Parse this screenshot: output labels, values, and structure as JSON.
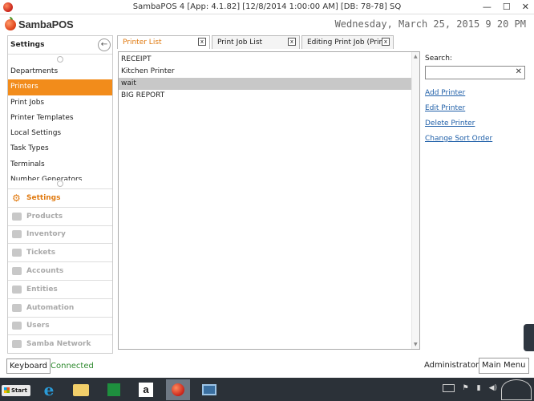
{
  "window": {
    "title": "SambaPOS 4 [App: 4.1.82] [12/8/2014 1:00:00 AM] [DB: 78-78] SQ",
    "minimize": "—",
    "maximize": "☐",
    "close": "✕"
  },
  "header": {
    "logo_text": "SambaPOS",
    "datetime": "Wednesday, March 25, 2015 9 20 PM"
  },
  "sidebar": {
    "title": "Settings",
    "back_icon": "←",
    "items": [
      {
        "label": "Departments"
      },
      {
        "label": "Printers",
        "active": true
      },
      {
        "label": "Print Jobs"
      },
      {
        "label": "Printer Templates"
      },
      {
        "label": "Local Settings"
      },
      {
        "label": "Task Types"
      },
      {
        "label": "Terminals"
      },
      {
        "label": "Number Generators"
      }
    ],
    "sections": [
      {
        "label": "Settings",
        "icon": "gear-icon",
        "active": true
      },
      {
        "label": "Products",
        "icon": "coffee-icon"
      },
      {
        "label": "Inventory",
        "icon": "truck-icon"
      },
      {
        "label": "Tickets",
        "icon": "tickets-icon"
      },
      {
        "label": "Accounts",
        "icon": "calculator-icon"
      },
      {
        "label": "Entities",
        "icon": "table-icon"
      },
      {
        "label": "Automation",
        "icon": "wand-icon"
      },
      {
        "label": "Users",
        "icon": "user-icon"
      },
      {
        "label": "Samba Network",
        "icon": "network-icon"
      }
    ]
  },
  "tabs": [
    {
      "label": "Printer List",
      "close": "x",
      "active": true
    },
    {
      "label": "Print Job List",
      "close": "x"
    },
    {
      "label": "Editing Print Job (Prin",
      "close": "x"
    }
  ],
  "printer_list": {
    "items": [
      {
        "label": "RECEIPT"
      },
      {
        "label": "Kitchen Printer"
      },
      {
        "label": "wait",
        "selected": true
      },
      {
        "label": "BIG REPORT"
      }
    ]
  },
  "actions": {
    "search_label": "Search:",
    "search_value": "",
    "search_clear": "✕",
    "add": "Add Printer",
    "edit": "Edit Printer",
    "delete": "Delete Printer",
    "sort": "Change Sort Order"
  },
  "status": {
    "keyboard": "Keyboard",
    "connection": "Connected",
    "user": "Administrator",
    "main_menu": "Main Menu"
  },
  "taskbar": {
    "start": "Start"
  }
}
